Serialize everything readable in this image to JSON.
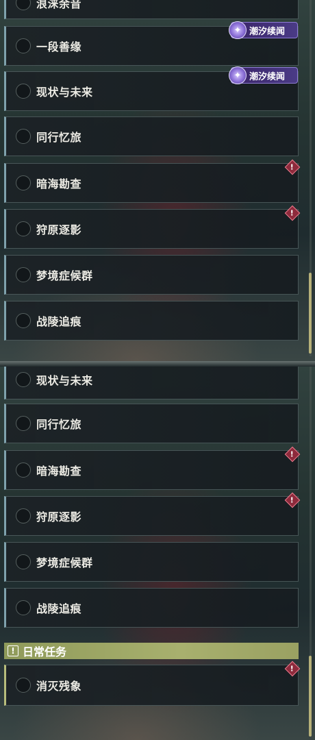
{
  "panel_top": {
    "items": [
      {
        "label": "浪涞余音"
      },
      {
        "label": "一段善缘",
        "badge": "潮汐续闻"
      },
      {
        "label": "现状与未来",
        "badge": "潮汐续闻"
      },
      {
        "label": "同行忆旅"
      },
      {
        "label": "暗海勘查",
        "warning": true
      },
      {
        "label": "狩原逐影",
        "warning": true
      },
      {
        "label": "梦境症候群"
      },
      {
        "label": "战陵追痕"
      }
    ]
  },
  "panel_bottom": {
    "items": [
      {
        "label": "现状与未来"
      },
      {
        "label": "同行忆旅"
      },
      {
        "label": "暗海勘查",
        "warning": true
      },
      {
        "label": "狩原逐影",
        "warning": true
      },
      {
        "label": "梦境症候群"
      },
      {
        "label": "战陵追痕"
      }
    ],
    "daily_section": {
      "title": "日常任务",
      "icon": "exclamation-icon",
      "items": [
        {
          "label": "消灭残象",
          "warning": true
        }
      ]
    }
  },
  "badge_icon_glyph": "✦",
  "warning_glyph": "!",
  "section_icon_glyph": "!",
  "colors": {
    "badge_bg": "#4a3b86",
    "warning": "#8e2a3c",
    "daily_header": "#a8b06e",
    "scroll_thumb": "#b7b17a"
  }
}
